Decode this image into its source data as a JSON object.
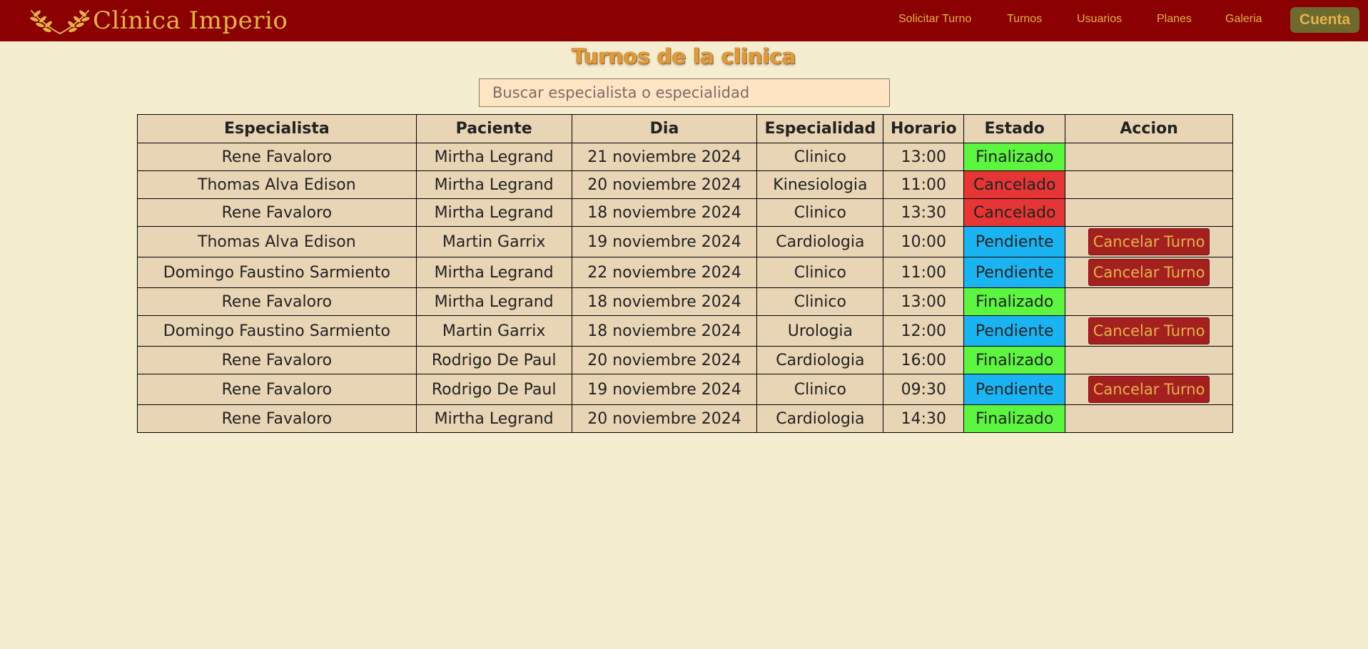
{
  "header": {
    "brand": "Clínica Imperio",
    "nav": [
      {
        "label": "Solicitar Turno"
      },
      {
        "label": "Turnos"
      },
      {
        "label": "Usuarios"
      },
      {
        "label": "Planes"
      },
      {
        "label": "Galeria"
      }
    ],
    "account_label": "Cuenta",
    "colors": {
      "navbar": "#8b0000",
      "accent": "#e4b24a",
      "account_button": "#6e6a2e"
    }
  },
  "main": {
    "title": "Turnos de la clinica",
    "search": {
      "placeholder": "Buscar especialista o especialidad",
      "value": ""
    },
    "table": {
      "columns": [
        "Especialista",
        "Paciente",
        "Dia",
        "Especialidad",
        "Horario",
        "Estado",
        "Accion"
      ],
      "action_label": "Cancelar Turno",
      "rows": [
        {
          "especialista": "Rene Favaloro",
          "paciente": "Mirtha Legrand",
          "dia": "21 noviembre 2024",
          "especialidad": "Clinico",
          "horario": "13:00",
          "estado": "Finalizado",
          "accion": ""
        },
        {
          "especialista": "Thomas Alva Edison",
          "paciente": "Mirtha Legrand",
          "dia": "20 noviembre 2024",
          "especialidad": "Kinesiologia",
          "horario": "11:00",
          "estado": "Cancelado",
          "accion": ""
        },
        {
          "especialista": "Rene Favaloro",
          "paciente": "Mirtha Legrand",
          "dia": "18 noviembre 2024",
          "especialidad": "Clinico",
          "horario": "13:30",
          "estado": "Cancelado",
          "accion": ""
        },
        {
          "especialista": "Thomas Alva Edison",
          "paciente": "Martin Garrix",
          "dia": "19 noviembre 2024",
          "especialidad": "Cardiologia",
          "horario": "10:00",
          "estado": "Pendiente",
          "accion": "Cancelar Turno"
        },
        {
          "especialista": "Domingo Faustino Sarmiento",
          "paciente": "Mirtha Legrand",
          "dia": "22 noviembre 2024",
          "especialidad": "Clinico",
          "horario": "11:00",
          "estado": "Pendiente",
          "accion": "Cancelar Turno"
        },
        {
          "especialista": "Rene Favaloro",
          "paciente": "Mirtha Legrand",
          "dia": "18 noviembre 2024",
          "especialidad": "Clinico",
          "horario": "13:00",
          "estado": "Finalizado",
          "accion": ""
        },
        {
          "especialista": "Domingo Faustino Sarmiento",
          "paciente": "Martin Garrix",
          "dia": "18 noviembre 2024",
          "especialidad": "Urologia",
          "horario": "12:00",
          "estado": "Pendiente",
          "accion": "Cancelar Turno"
        },
        {
          "especialista": "Rene Favaloro",
          "paciente": "Rodrigo De Paul",
          "dia": "20 noviembre 2024",
          "especialidad": "Cardiologia",
          "horario": "16:00",
          "estado": "Finalizado",
          "accion": ""
        },
        {
          "especialista": "Rene Favaloro",
          "paciente": "Rodrigo De Paul",
          "dia": "19 noviembre 2024",
          "especialidad": "Clinico",
          "horario": "09:30",
          "estado": "Pendiente",
          "accion": "Cancelar Turno"
        },
        {
          "especialista": "Rene Favaloro",
          "paciente": "Mirtha Legrand",
          "dia": "20 noviembre 2024",
          "especialidad": "Cardiologia",
          "horario": "14:30",
          "estado": "Finalizado",
          "accion": ""
        }
      ]
    },
    "status_colors": {
      "Finalizado": "#5cf540",
      "Cancelado": "#e53535",
      "Pendiente": "#1ab4f2"
    },
    "background": "#f5edd0"
  }
}
